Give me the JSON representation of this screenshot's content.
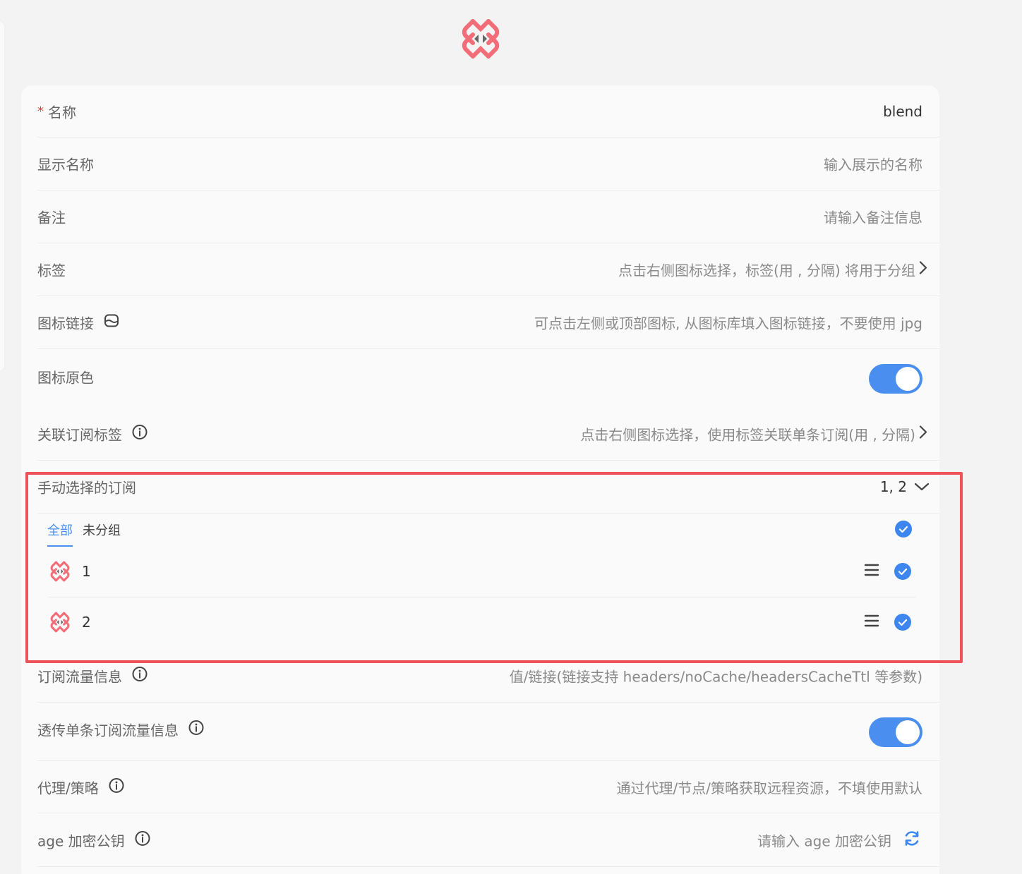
{
  "colors": {
    "accent": "#4a8ff0",
    "highlight": "#f0525a",
    "required": "#e0503c",
    "logo_pink": "#f26d78",
    "logo_arrows": "#666666"
  },
  "header": {
    "logo_icon": "sub-store-logo-icon"
  },
  "form": {
    "name": {
      "required_mark": "*",
      "label": "名称",
      "value": "blend"
    },
    "display_name": {
      "label": "显示名称",
      "placeholder": "输入展示的名称"
    },
    "remark": {
      "label": "备注",
      "placeholder": "请输入备注信息"
    },
    "tags": {
      "label": "标签",
      "placeholder": "点击右侧图标选择，标签(用 , 分隔) 将用于分组"
    },
    "icon_link": {
      "label": "图标链接",
      "icon": "image-icon",
      "placeholder": "可点击左侧或顶部图标, 从图标库填入图标链接，不要使用 jpg"
    },
    "icon_original_color": {
      "label": "图标原色",
      "enabled": true
    },
    "linked_sub_tags": {
      "label": "关联订阅标签",
      "placeholder": "点击右侧图标选择，使用标签关联单条订阅(用 , 分隔)"
    },
    "manual_subs": {
      "label": "手动选择的订阅",
      "value": "1, 2",
      "tabs": [
        "全部",
        "未分组"
      ],
      "all_selected": true,
      "items": [
        {
          "name": "1",
          "selected": true
        },
        {
          "name": "2",
          "selected": true
        }
      ]
    },
    "traffic_info": {
      "label": "订阅流量信息",
      "placeholder": "值/链接(链接支持 headers/noCache/headersCacheTtl 等参数)"
    },
    "passthrough_traffic": {
      "label": "透传单条订阅流量信息",
      "enabled": true
    },
    "proxy": {
      "label": "代理/策略",
      "placeholder": "通过代理/节点/策略获取远程资源，不填使用默认"
    },
    "age_key": {
      "label": "age 加密公钥",
      "placeholder": "请输入 age 加密公钥",
      "action_icon": "refresh-icon"
    }
  }
}
